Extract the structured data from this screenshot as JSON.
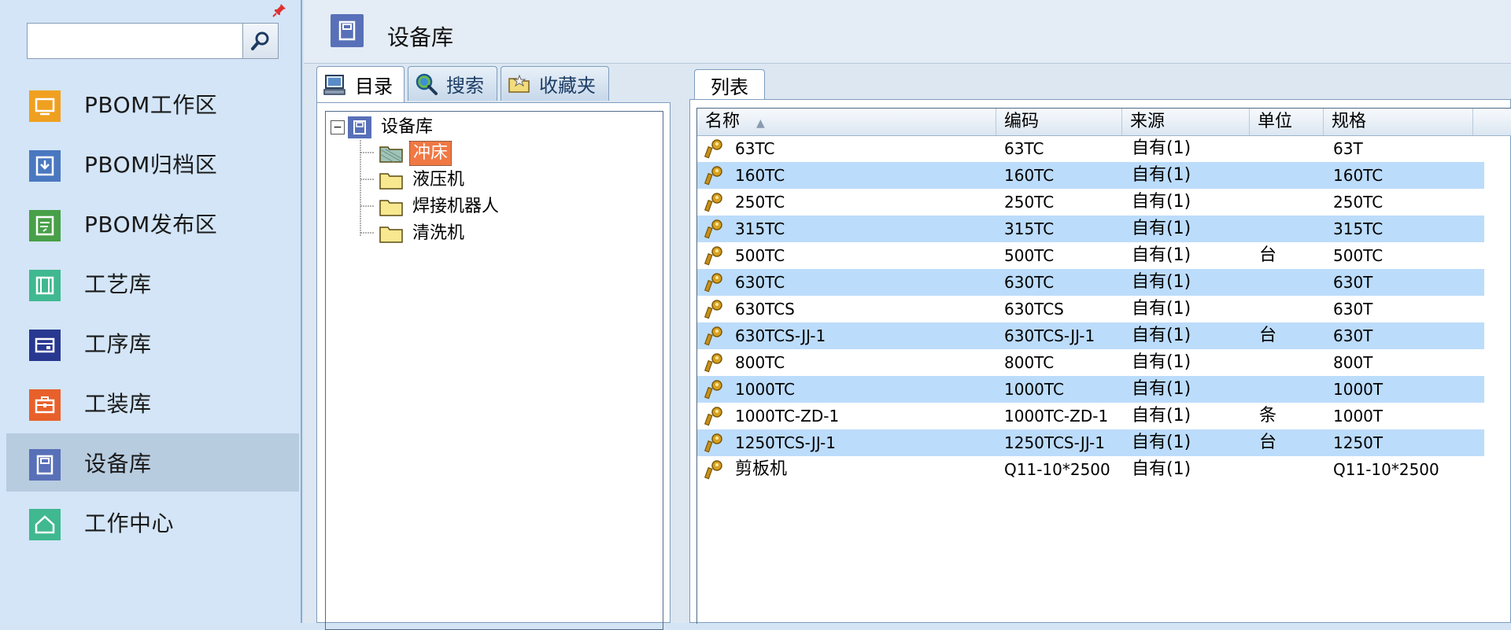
{
  "colors": {
    "sidebar_bg": "#d3e5f7",
    "active_nav": "#b8cce0",
    "row_alt": "#bcdcfb",
    "selected_node": "#f07844"
  },
  "sidebar": {
    "search": {
      "value": "",
      "placeholder": ""
    },
    "items": [
      {
        "label": "PBOM工作区",
        "icon": "monitor-icon",
        "color": "#f0a020"
      },
      {
        "label": "PBOM归档区",
        "icon": "archive-icon",
        "color": "#4a78c0"
      },
      {
        "label": "PBOM发布区",
        "icon": "publish-icon",
        "color": "#48a048"
      },
      {
        "label": "工艺库",
        "icon": "process-icon",
        "color": "#40b890"
      },
      {
        "label": "工序库",
        "icon": "operation-icon",
        "color": "#283890"
      },
      {
        "label": "工装库",
        "icon": "toolbox-icon",
        "color": "#e8602a"
      },
      {
        "label": "设备库",
        "icon": "device-icon",
        "color": "#5870b8"
      },
      {
        "label": "工作中心",
        "icon": "home-icon",
        "color": "#40b890"
      }
    ],
    "active_index": 6
  },
  "header": {
    "title": "设备库"
  },
  "left_tabs": [
    {
      "label": "目录",
      "icon": "catalog-icon"
    },
    {
      "label": "搜索",
      "icon": "search-icon"
    },
    {
      "label": "收藏夹",
      "icon": "favorites-icon"
    }
  ],
  "tree": {
    "root": {
      "label": "设备库",
      "expand_symbol": "⊟"
    },
    "children": [
      {
        "label": "冲床",
        "selected": true
      },
      {
        "label": "液压机",
        "selected": false
      },
      {
        "label": "焊接机器人",
        "selected": false
      },
      {
        "label": "清洗机",
        "selected": false
      }
    ]
  },
  "right_tabs": [
    {
      "label": "列表"
    }
  ],
  "table": {
    "columns": [
      "名称",
      "编码",
      "来源",
      "单位",
      "规格"
    ],
    "sort_indicator": "▲",
    "rows": [
      [
        "63TC",
        "63TC",
        "自有(1)",
        "",
        "63T"
      ],
      [
        "160TC",
        "160TC",
        "自有(1)",
        "",
        "160TC"
      ],
      [
        "250TC",
        "250TC",
        "自有(1)",
        "",
        "250TC"
      ],
      [
        "315TC",
        "315TC",
        "自有(1)",
        "",
        "315TC"
      ],
      [
        "500TC",
        "500TC",
        "自有(1)",
        "台",
        "500TC"
      ],
      [
        "630TC",
        "630TC",
        "自有(1)",
        "",
        "630T"
      ],
      [
        "630TCS",
        "630TCS",
        "自有(1)",
        "",
        "630T"
      ],
      [
        "630TCS-JJ-1",
        "630TCS-JJ-1",
        "自有(1)",
        "台",
        "630T"
      ],
      [
        "800TC",
        "800TC",
        "自有(1)",
        "",
        "800T"
      ],
      [
        "1000TC",
        "1000TC",
        "自有(1)",
        "",
        "1000T"
      ],
      [
        "1000TC-ZD-1",
        "1000TC-ZD-1",
        "自有(1)",
        "条",
        "1000T"
      ],
      [
        "1250TCS-JJ-1",
        "1250TCS-JJ-1",
        "自有(1)",
        "台",
        "1250T"
      ],
      [
        "剪板机",
        "Q11-10*2500",
        "自有(1)",
        "",
        "Q11-10*2500"
      ]
    ]
  }
}
